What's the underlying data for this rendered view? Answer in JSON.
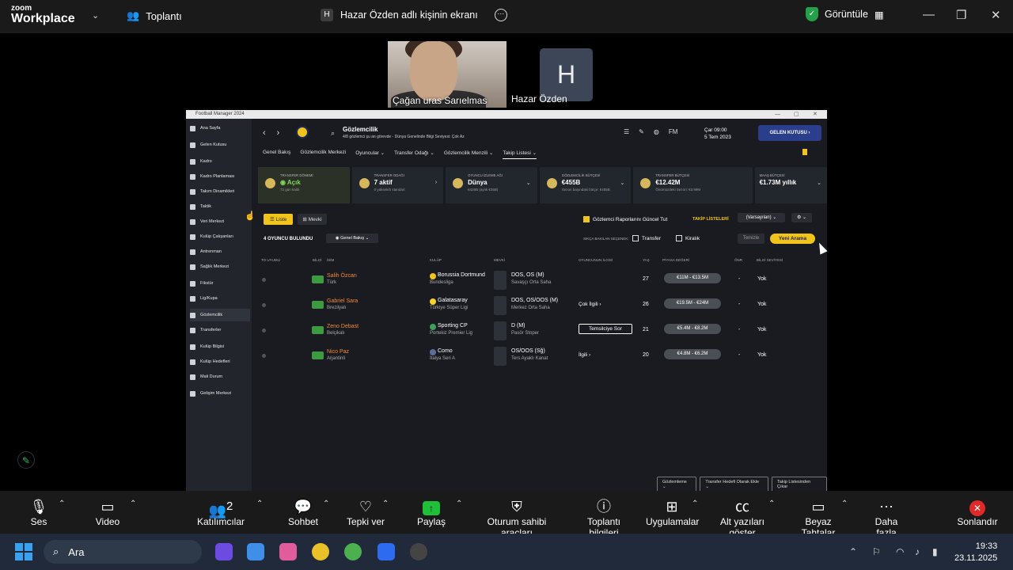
{
  "zoom": {
    "logo_top": "zoom",
    "logo_bottom": "Workplace",
    "meeting_label": "Toplantı",
    "share_label": "Hazar Özden adlı kişinin ekranı",
    "share_badge": "H",
    "view_label": "Görüntüle",
    "participants": [
      {
        "name": "Çağan uras Sarıelmas"
      },
      {
        "name": "Hazar Özden",
        "initial": "H"
      }
    ],
    "toolbar": [
      {
        "label": "Ses",
        "icon": "microphone-icon"
      },
      {
        "label": "Video",
        "icon": "video-camera-icon"
      },
      {
        "label": "Katılımcılar",
        "icon": "participants-icon",
        "count": "2"
      },
      {
        "label": "Sohbet",
        "icon": "chat-icon"
      },
      {
        "label": "Tepki ver",
        "icon": "heart-icon"
      },
      {
        "label": "Paylaş",
        "icon": "share-arrow-icon"
      },
      {
        "label": "Oturum sahibi araçları",
        "icon": "host-shield-icon"
      },
      {
        "label": "Toplantı bilgileri",
        "icon": "info-icon"
      },
      {
        "label": "Uygulamalar",
        "icon": "apps-icon"
      },
      {
        "label": "Alt yazıları göster",
        "icon": "cc-icon"
      },
      {
        "label": "Beyaz Tahtalar",
        "icon": "whiteboard-icon"
      },
      {
        "label": "Daha fazla",
        "icon": "more-icon"
      },
      {
        "label": "Sonlandır",
        "icon": "end-icon"
      }
    ]
  },
  "fm": {
    "window_title": "Football Manager 2024",
    "sidebar": [
      "Ana Sayfa",
      "Gelen Kutusu",
      "Kadro",
      "Kadro Planlaması",
      "Takım Dinamikleri",
      "Taktik",
      "Veri Merkezi",
      "Kulüp Çalışanları",
      "Antrenman",
      "Sağlık Merkezi",
      "Fikstür",
      "Lig/Kupa",
      "Gözlemcilik",
      "Transferler",
      "Kulüp Bilgisi",
      "Kulüp Hedefleri",
      "Mali Durum",
      "Gelişim Merkezi"
    ],
    "header": {
      "title": "Gözlemcilik",
      "subtitle": "4/8 gözlemci şu an görevde - Dünya Genelinde Bilgi Seviyesi: Çok Az",
      "date_line1": "Çar 09:00",
      "date_line2": "5 Tem 2023",
      "inbox_label": "GELEN KUTUSU",
      "fm_label": "FM"
    },
    "tabs": [
      "Genel Bakış",
      "Gözlemcilik Merkezi",
      "Oyuncular ⌄",
      "Transfer Odağı ⌄",
      "Gözlemcilik Menzili ⌄",
      "Takip Listesi ⌄"
    ],
    "stats": [
      {
        "label": "TRANSFER DÖNEMİ",
        "value": "◉ Açık",
        "sub": "72 gün kaldı"
      },
      {
        "label": "TRANSFER ODAĞI",
        "value": "7 aktif",
        "sub": "0 yüksek/0 standart"
      },
      {
        "label": "OYUNCU İZLEME AĞI",
        "value": "Dünya",
        "sub": "€420B (aylık €35B)"
      },
      {
        "label": "GÖZLEMCİLİK BÜTÇESİ",
        "value": "€455B",
        "sub": "Sezon başındaki bütçe: €455B"
      },
      {
        "label": "TRANSFER BÜTÇESİ",
        "value": "€12.42M",
        "sub": "Önümüzdeki Sezon: €3.99M"
      },
      {
        "label": "MAAŞ BÜTÇESİ",
        "value": "€1.73M yıllık",
        "sub": ""
      }
    ],
    "controls": {
      "list_label": "Liste",
      "position_label": "Mevki",
      "keep_updated": "Gözlemci Raporlarını Güncel Tut",
      "track_lists": "TAKİP LİSTELERİ",
      "default": "(Varsayılan)",
      "found": "4 OYUNCU BULUNDU",
      "overview": "Genel Bakış",
      "quick_select": "SIKÇA BAKILAN SEÇENEK:",
      "transfer": "Transfer",
      "loan": "Kiralık",
      "clear": "Temizle",
      "new_search": "Yeni Arama"
    },
    "columns": [
      "TO UYUMU",
      "BİLGİ",
      "İSİM",
      "KULÜP",
      "MEVKİ",
      "OYUNCUNUN İLGİSİ",
      "YAŞ",
      "PİYASA DEĞERİ",
      "ÖNR",
      "BİLGİ SEVİYESİ"
    ],
    "players": [
      {
        "name": "Salih Özcan",
        "nat": "Türk",
        "club": "Borussia Dortmund",
        "league": "Bundesliga",
        "pos": "DOS, OS (M)",
        "role": "Savaşçı Orta Saha",
        "interest": "",
        "age": "27",
        "value": "€11M - €13.5M",
        "onr": "-",
        "info": "Yok"
      },
      {
        "name": "Gabriel Sara",
        "nat": "Brezilyalı",
        "club": "Galatasaray",
        "league": "Türkiye Süper Ligi",
        "pos": "DOS, OS/OOS (M)",
        "role": "Merkez Orta Saha",
        "interest": "Çok İlgili ›",
        "age": "26",
        "value": "€19.5M - €24M",
        "onr": "-",
        "info": "Yok"
      },
      {
        "name": "Zeno Debast",
        "nat": "Belçikalı",
        "club": "Sporting CP",
        "league": "Portekiz Premier Lig",
        "pos": "D (M)",
        "role": "Pasör Stoper",
        "interest": "Temsilciye Sor",
        "age": "21",
        "value": "€5.4M - €8.2M",
        "onr": "-",
        "info": "Yok"
      },
      {
        "name": "Nico Paz",
        "nat": "Arjantinli",
        "club": "Como",
        "league": "İtalya Seri A",
        "pos": "OS/OOS (Sğ)",
        "role": "Ters Ayaklı Kanat",
        "interest": "İlgili ›",
        "age": "20",
        "value": "€4.8M - €6.2M",
        "onr": "-",
        "info": "Yok"
      }
    ],
    "bottom_buttons": [
      "Gözlemleme ⌄",
      "Transfer Hedefi Olarak Ekle ⌄",
      "Takip Listesinden Çıkar"
    ]
  },
  "taskbar": {
    "search_placeholder": "Ara",
    "time": "19:33",
    "date": "23.11.2025"
  },
  "colors": {
    "accent": "#f0c419",
    "player_name": "#f08b3b",
    "share_green": "#1fbf3a",
    "end_red": "#e02929"
  }
}
